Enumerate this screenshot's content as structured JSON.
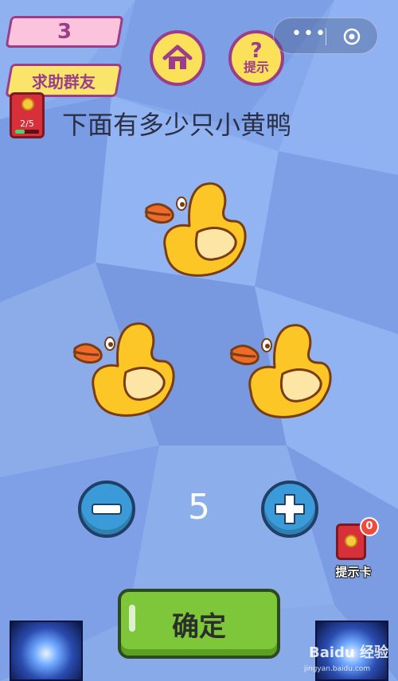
{
  "header": {
    "level": "3",
    "help_button": "求助群友",
    "hint_button": "提示",
    "progress_text": "2/5",
    "progress_fraction": 0.4
  },
  "question": "下面有多少只小黄鸭",
  "counter": {
    "value": "5"
  },
  "hint_card": {
    "label": "提示卡",
    "count": "0"
  },
  "confirm_button": "确定",
  "watermark": {
    "title": "Baidu 经验",
    "url": "jingyan.baidu.com"
  },
  "icons": {
    "home": "home-icon",
    "question": "question-mark-icon",
    "minus": "minus-icon",
    "plus": "plus-icon",
    "more": "more-dots-icon",
    "close": "target-close-icon"
  }
}
